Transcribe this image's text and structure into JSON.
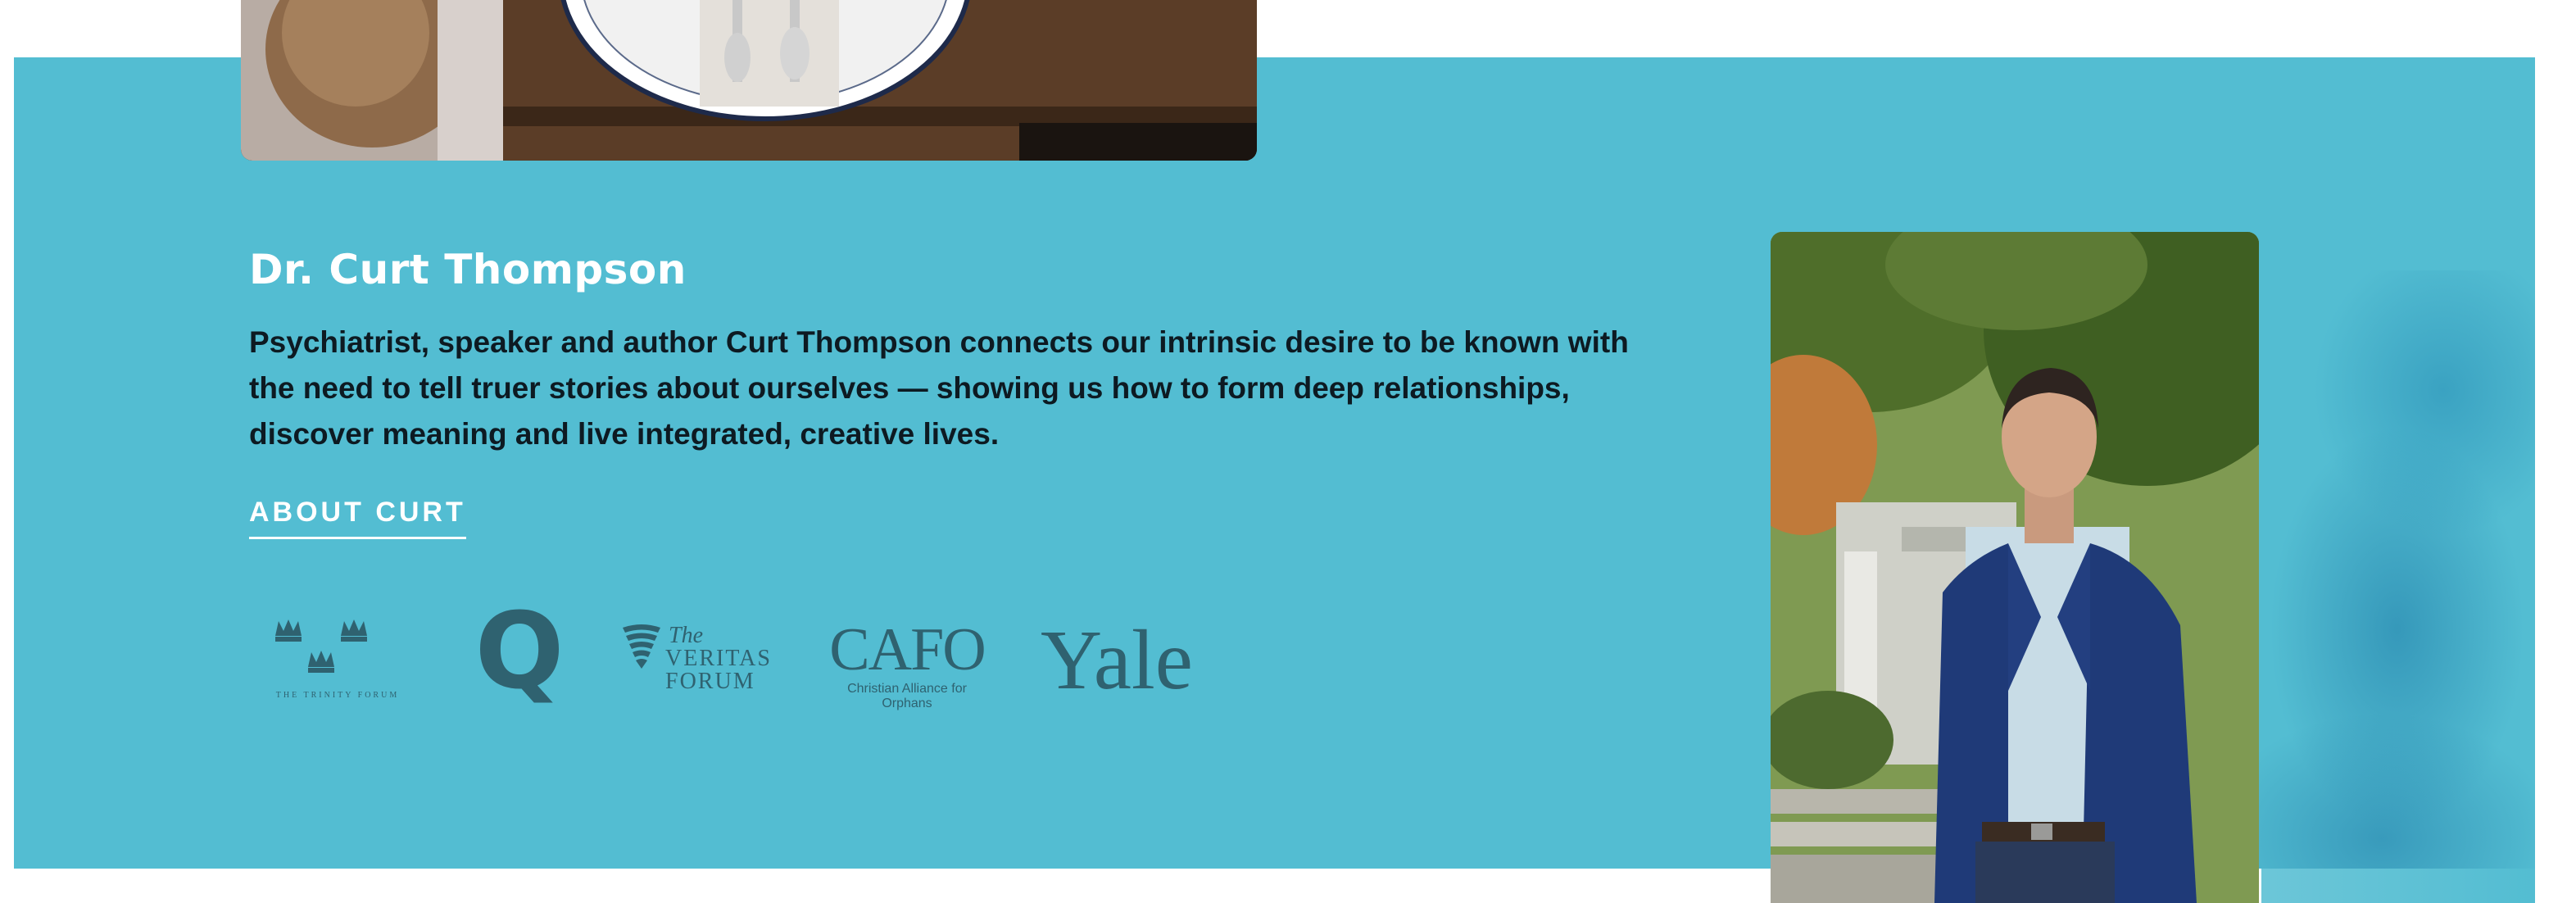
{
  "hero": {
    "name": "Dr. Curt Thompson",
    "bio": "Psychiatrist, speaker and author Curt Thompson connects our intrinsic desire to be known with the need to tell truer stories about ourselves — showing us how to form deep relationships, discover meaning and live integrated, creative lives.",
    "about_link": "ABOUT CURT"
  },
  "logos": {
    "trinity": {
      "label": "THE TRINITY FORUM"
    },
    "q": {
      "label": "Q"
    },
    "veritas": {
      "the": "The",
      "main": "VERITAS",
      "sub": "FORUM"
    },
    "cafo": {
      "main": "CAFO",
      "sub": "Christian Alliance for Orphans"
    },
    "yale": {
      "label": "Yale"
    }
  },
  "colors": {
    "band": "#53BDD2",
    "logo": "#2f6270",
    "heading": "#ffffff",
    "body_text": "#0d1a22"
  }
}
